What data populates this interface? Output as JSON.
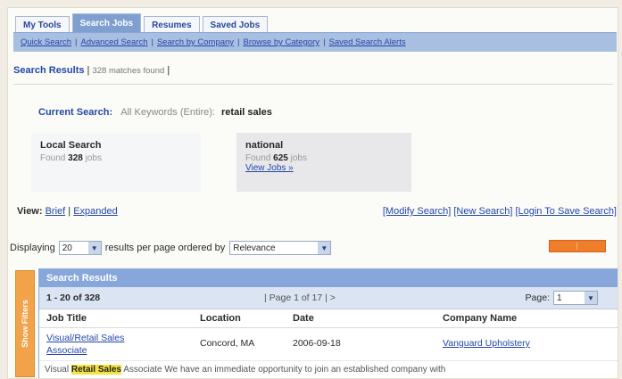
{
  "tabs": [
    "My Tools",
    "Search Jobs",
    "Resumes",
    "Saved Jobs"
  ],
  "subnav": [
    "Quick Search",
    "Advanced Search",
    "Search by Company",
    "Browse by Category",
    "Saved Search Alerts"
  ],
  "results_header": {
    "title": "Search Results",
    "count": "328 matches found"
  },
  "current_search": {
    "label": "Current Search:",
    "keywords": "All Keywords (Entire):",
    "term": "retail sales"
  },
  "local": {
    "title": "Local Search",
    "found_prefix": "Found",
    "count": "328",
    "suffix": "jobs"
  },
  "national": {
    "title": "national",
    "found_prefix": "Found",
    "count": "625",
    "suffix": "jobs",
    "link": "View Jobs »"
  },
  "view": {
    "label": "View:",
    "brief": "Brief",
    "expanded": "Expanded"
  },
  "actions": [
    "[Modify Search]",
    "[New Search]",
    "[Login To Save Search]"
  ],
  "display": {
    "prefix": "Displaying",
    "per_page": "20",
    "middle": "results per page ordered by",
    "order": "Relevance"
  },
  "filters_label": "Show Filters",
  "panel": {
    "title": "Search Results",
    "range": "1 - 20 of 328",
    "page_info": "| Page 1 of 17 | >",
    "page_label": "Page:",
    "page_value": "1",
    "columns": [
      "Job Title",
      "Location",
      "Date",
      "Company Name"
    ],
    "rows": [
      {
        "title_1": "Visual/Retail Sales",
        "title_2": "Associate",
        "location": "Concord, MA",
        "date": "2006-09-18",
        "company": "Vanguard Upholstery"
      }
    ],
    "desc_prefix": "Visual",
    "desc_highlight": "Retail Sales",
    "desc_rest": "Associate We have an immediate opportunity to join an established company with"
  }
}
